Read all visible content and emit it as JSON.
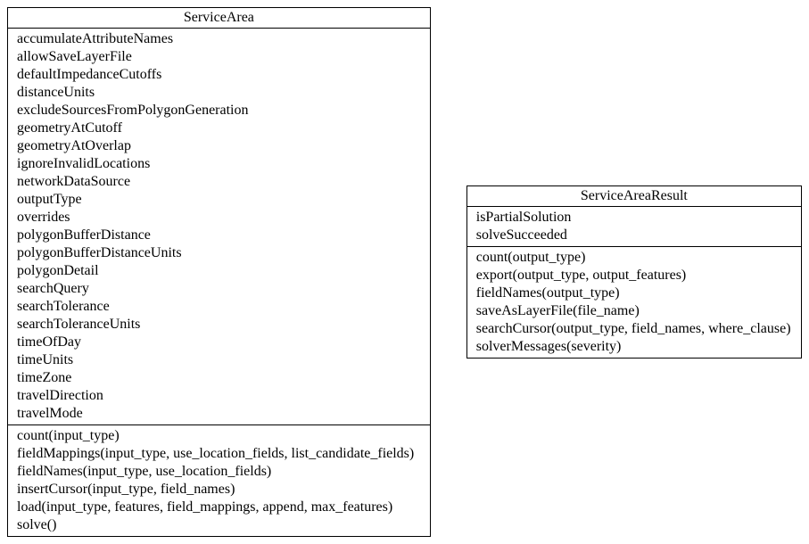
{
  "left": {
    "title": "ServiceArea",
    "attributes": [
      "accumulateAttributeNames",
      "allowSaveLayerFile",
      "defaultImpedanceCutoffs",
      "distanceUnits",
      "excludeSourcesFromPolygonGeneration",
      "geometryAtCutoff",
      "geometryAtOverlap",
      "ignoreInvalidLocations",
      "networkDataSource",
      "outputType",
      "overrides",
      "polygonBufferDistance",
      "polygonBufferDistanceUnits",
      "polygonDetail",
      "searchQuery",
      "searchTolerance",
      "searchToleranceUnits",
      "timeOfDay",
      "timeUnits",
      "timeZone",
      "travelDirection",
      "travelMode"
    ],
    "methods": [
      "count(input_type)",
      "fieldMappings(input_type, use_location_fields, list_candidate_fields)",
      "fieldNames(input_type, use_location_fields)",
      "insertCursor(input_type, field_names)",
      "load(input_type, features, field_mappings, append, max_features)",
      "solve()"
    ]
  },
  "right": {
    "title": "ServiceAreaResult",
    "attributes": [
      "isPartialSolution",
      "solveSucceeded"
    ],
    "methods": [
      "count(output_type)",
      "export(output_type, output_features)",
      "fieldNames(output_type)",
      "saveAsLayerFile(file_name)",
      "searchCursor(output_type, field_names, where_clause)",
      "solverMessages(severity)"
    ]
  }
}
